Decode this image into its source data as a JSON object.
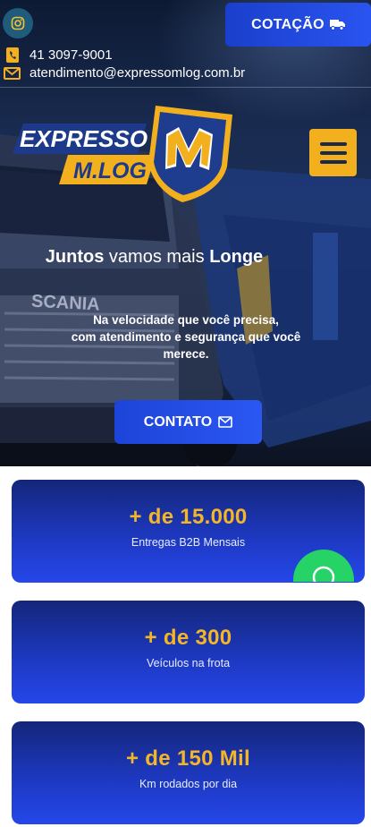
{
  "header": {
    "cotacao_label": "COTAÇÃO",
    "phone": "41 3097-9001",
    "email": "atendimento@expressomlog.com.br",
    "icons": {
      "instagram": "instagram-icon",
      "truck": "truck-icon",
      "phone": "phone-icon",
      "email": "envelope-icon",
      "menu": "hamburger-menu-icon"
    }
  },
  "logo": {
    "line1": "EXPRESSO",
    "line2": "M.LOG",
    "emblem_letter": "M"
  },
  "hero": {
    "headline_bold1": "Juntos",
    "headline_mid": "vamos mais",
    "headline_bold2": "Longe",
    "sub_line1": "Na velocidade que você precisa,",
    "sub_line2": "com atendimento e segurança que você",
    "sub_line3": "merece.",
    "contato_label": "CONTATO",
    "truck_text": "SCANIA"
  },
  "stats": [
    {
      "value": "+ de 15.000",
      "label": "Entregas B2B Mensais"
    },
    {
      "value": "+ de 300",
      "label": "Veículos na frota"
    },
    {
      "value": "+ de 150 Mil",
      "label": "Km rodados por dia"
    }
  ],
  "colors": {
    "accent_yellow": "#f2b01e",
    "button_blue": "#2a54f0",
    "whatsapp_green": "#25d366"
  }
}
